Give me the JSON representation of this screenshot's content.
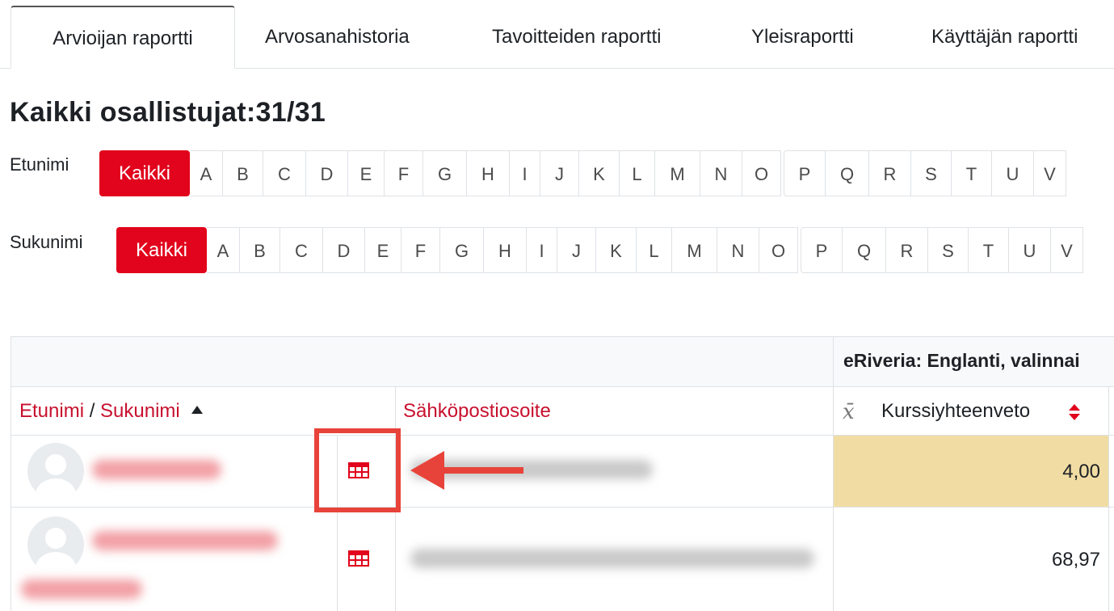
{
  "tabs": [
    {
      "label": "Arvioijan raportti",
      "active": true
    },
    {
      "label": "Arvosanahistoria"
    },
    {
      "label": "Tavoitteiden raportti"
    },
    {
      "label": "Yleisraportti"
    },
    {
      "label": "Käyttäjän raportti"
    }
  ],
  "page_title": "Kaikki osallistujat:31/31",
  "firstname_filter": {
    "label": "Etunimi",
    "all_label": "Kaikki",
    "letters": [
      "A",
      "B",
      "C",
      "D",
      "E",
      "F",
      "G",
      "H",
      "I",
      "J",
      "K",
      "L",
      "M",
      "N",
      "O",
      "P",
      "Q",
      "R",
      "S",
      "T",
      "U",
      "V"
    ]
  },
  "lastname_filter": {
    "label": "Sukunimi",
    "all_label": "Kaikki",
    "letters": [
      "A",
      "B",
      "C",
      "D",
      "E",
      "F",
      "G",
      "H",
      "I",
      "J",
      "K",
      "L",
      "M",
      "N",
      "O",
      "P",
      "Q",
      "R",
      "S",
      "T",
      "U",
      "V"
    ]
  },
  "table": {
    "category_header": "eRiveria: Englanti, valinnai",
    "col_firstname": "Etunimi",
    "col_separator": " / ",
    "col_lastname": "Sukunimi",
    "col_email": "Sähköpostiosoite",
    "col_mean_symbol": "x̄",
    "col_course_total": "Kurssiyhteenveto",
    "rows": [
      {
        "grade": "4,00",
        "highlight_color": "#f1dda4"
      },
      {
        "grade": "68,97"
      }
    ]
  },
  "colors": {
    "accent": "#e1041c",
    "link": "#c8102e",
    "annotation": "#e8433a"
  }
}
